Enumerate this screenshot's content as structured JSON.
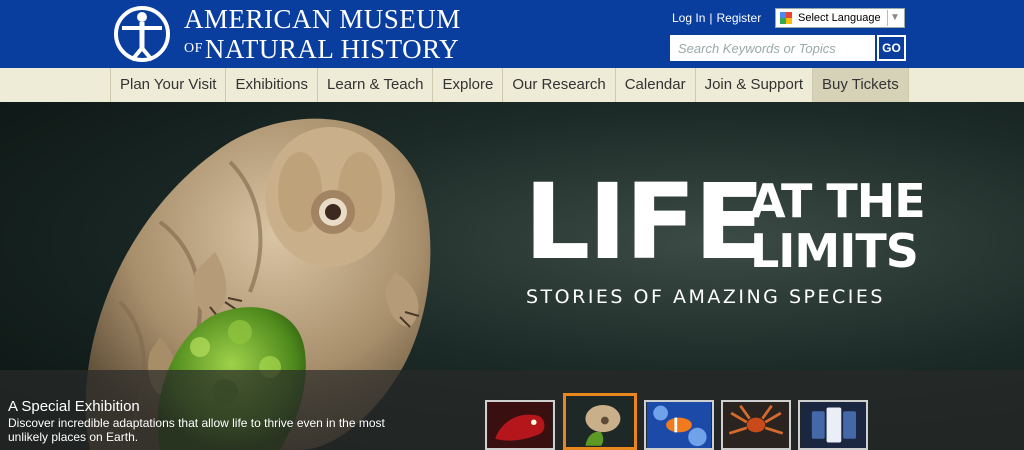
{
  "header": {
    "logo_line1": "American Museum",
    "logo_of": "of",
    "logo_line2": "Natural History",
    "login": "Log In",
    "separator": "|",
    "register": "Register",
    "language": "Select Language",
    "search_placeholder": "Search Keywords or Topics",
    "search_button": "GO",
    "brand_color": "#0a3e9e"
  },
  "nav": {
    "items": [
      {
        "label": "Plan Your Visit"
      },
      {
        "label": "Exhibitions"
      },
      {
        "label": "Learn & Teach"
      },
      {
        "label": "Explore"
      },
      {
        "label": "Our Research"
      },
      {
        "label": "Calendar"
      },
      {
        "label": "Join & Support"
      },
      {
        "label": "Buy Tickets"
      }
    ]
  },
  "hero": {
    "title_big": "LIFE",
    "title_at": "AT THE",
    "title_limits": "LIMITS",
    "subtitle": "STORIES OF AMAZING SPECIES",
    "caption_title": "A Special Exhibition",
    "caption_desc": "Discover incredible adaptations that allow life to thrive even in the most unlikely places on Earth.",
    "active_thumb_color": "#e8871e",
    "thumbnails": [
      {
        "icon": "red-creature-thumbnail"
      },
      {
        "icon": "tardigrade-thumbnail"
      },
      {
        "icon": "clownfish-thumbnail"
      },
      {
        "icon": "spider-thumbnail"
      },
      {
        "icon": "mobile-app-thumbnail"
      }
    ]
  }
}
